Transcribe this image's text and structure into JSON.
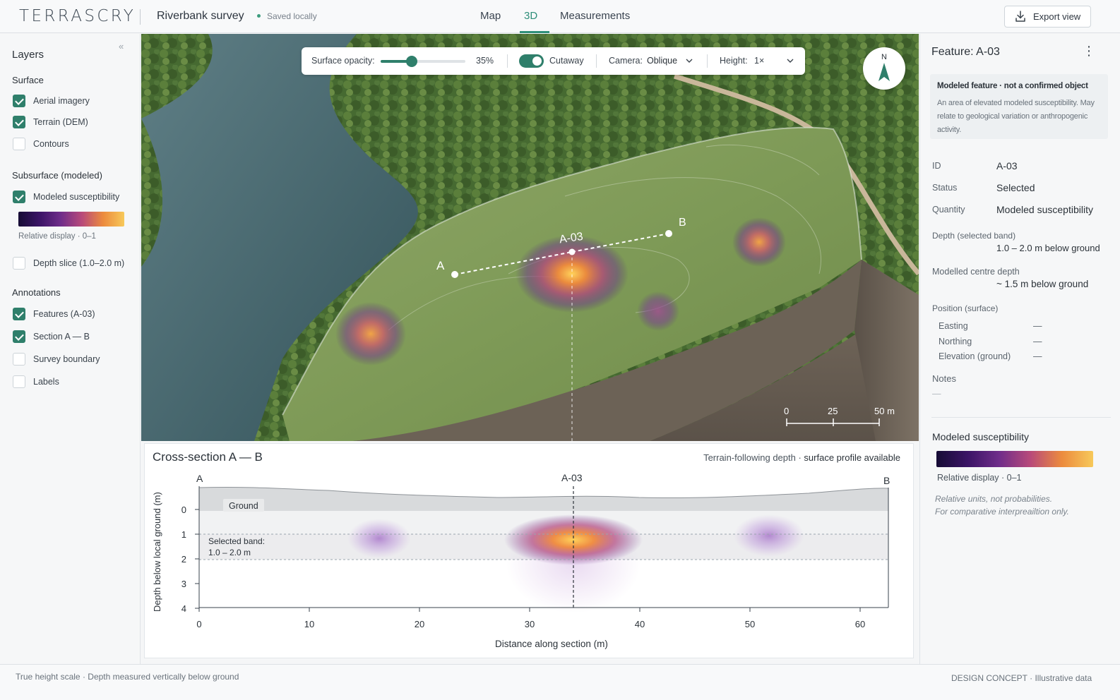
{
  "header": {
    "brand": "TERRASCRY",
    "project": "Riverbank survey",
    "save_status": "Saved locally",
    "tabs": [
      "Map",
      "3D",
      "Measurements"
    ],
    "active_tab": "3D",
    "export_label": "Export view",
    "accent": "#2f8f7a"
  },
  "layers": {
    "title": "Layers",
    "surface_title": "Surface",
    "surface": [
      {
        "label": "Aerial imagery",
        "checked": true
      },
      {
        "label": "Terrain (DEM)",
        "checked": true
      },
      {
        "label": "Contours",
        "checked": false
      }
    ],
    "subsurface_title": "Subsurface (modeled)",
    "subsurface": [
      {
        "label": "Modeled susceptibility",
        "checked": true
      }
    ],
    "legend_caption": "Relative display · 0–1",
    "depth_slice": {
      "label": "Depth slice (1.0–2.0 m)",
      "checked": false
    },
    "annotations_title": "Annotations",
    "annotations": [
      {
        "label": "Features (A-03)",
        "checked": true
      },
      {
        "label": "Section A — B",
        "checked": true
      },
      {
        "label": "Survey boundary",
        "checked": false
      },
      {
        "label": "Labels",
        "checked": false
      }
    ]
  },
  "toolbar": {
    "opacity_label": "Surface opacity:",
    "opacity_value": "35%",
    "opacity_fraction": 0.35,
    "cutaway_label": "Cutaway",
    "cutaway_on": true,
    "camera_label": "Camera:",
    "camera_value": "Oblique",
    "height_label": "Height:",
    "height_value": "1×"
  },
  "viewport": {
    "compass_label": "N",
    "marker_a": "A",
    "marker_b": "B",
    "feature_label": "A-03",
    "scale_ticks": [
      "0",
      "25",
      "50 m"
    ]
  },
  "cross_section": {
    "title": "Cross-section A — B",
    "info_prefix": "Terrain-following depth",
    "info_suffix": "surface profile available",
    "left_end": "A",
    "right_end": "B",
    "feature_label": "A-03",
    "ground_label": "Ground",
    "band_label_1": "Selected band:",
    "band_label_2": "1.0 – 2.0 m",
    "x_ticks": [
      "0",
      "10",
      "20",
      "30",
      "40",
      "50",
      "60"
    ],
    "y_ticks": [
      "0",
      "1",
      "2",
      "3",
      "4"
    ],
    "xlabel": "Distance along section (m)",
    "ylabel": "Depth below local ground (m)"
  },
  "feature": {
    "title": "Feature: A-03",
    "note_heading": "Modeled feature · not a confirmed object",
    "note_body": "An area of elevated modeled susceptibility. May relate to geological variation or anthropogenic activity.",
    "id_label": "ID",
    "id_value": "A-03",
    "status_label": "Status",
    "status_value": "Selected",
    "quantity_label": "Quantity",
    "quantity_value": "Modeled susceptibility",
    "depth_label": "Depth (selected band)",
    "depth_value": "1.0 – 2.0 m below ground",
    "centre_label": "Modelled centre depth",
    "centre_value": "~ 1.5 m below ground",
    "position_label": "Position (surface)",
    "easting_label": "Easting",
    "easting_value": "—",
    "northing_label": "Northing",
    "northing_value": "—",
    "elevation_label": "Elevation (ground)",
    "elevation_value": "—",
    "notes_label": "Notes",
    "notes_value": "—",
    "legend_title": "Modeled susceptibility",
    "legend_caption": "Relative display · 0–1",
    "legend_note_1": "Relative units, not probabilities.",
    "legend_note_2": "For comparative interpreailtion only."
  },
  "footer": {
    "left_1": "True height scale",
    "left_2": "Depth measured vertically below ground",
    "right_1": "DESIGN CONCEPT",
    "right_2": "Illustrative data"
  }
}
